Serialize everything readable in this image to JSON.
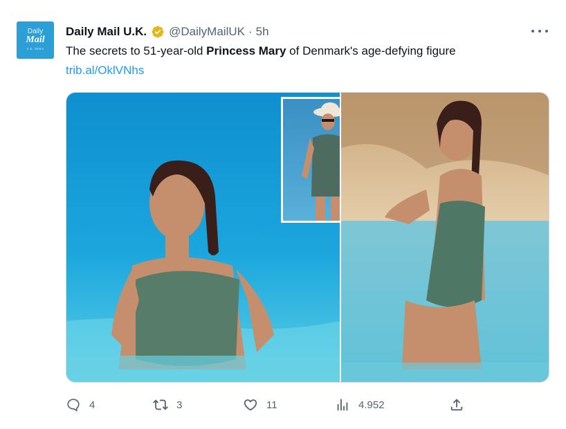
{
  "tweet": {
    "avatar": {
      "line1": "Daily",
      "line2": "Mail",
      "line3": "U.K. NEWS"
    },
    "author_name": "Daily Mail U.K.",
    "handle": "@DailyMailUK",
    "separator": "·",
    "time": "5h",
    "text_before": "The secrets to 51-year-old ",
    "text_bold": "Princess Mary",
    "text_after": " of Denmark's age-defying figure",
    "link": "trib.al/OklVNhs",
    "icons": {
      "verified": "verified-badge-icon",
      "more": "more-options-icon",
      "reply": "reply-icon",
      "retweet": "retweet-icon",
      "like": "like-icon",
      "views": "views-icon",
      "share": "share-icon"
    },
    "colors": {
      "accent": "#1d9bf0",
      "verified_gold": "#e2b719",
      "secondary_text": "#536471",
      "avatar_bg": "#2b9fd6"
    }
  },
  "actions": {
    "replies": "4",
    "retweets": "3",
    "likes": "11",
    "views": "4.952"
  }
}
